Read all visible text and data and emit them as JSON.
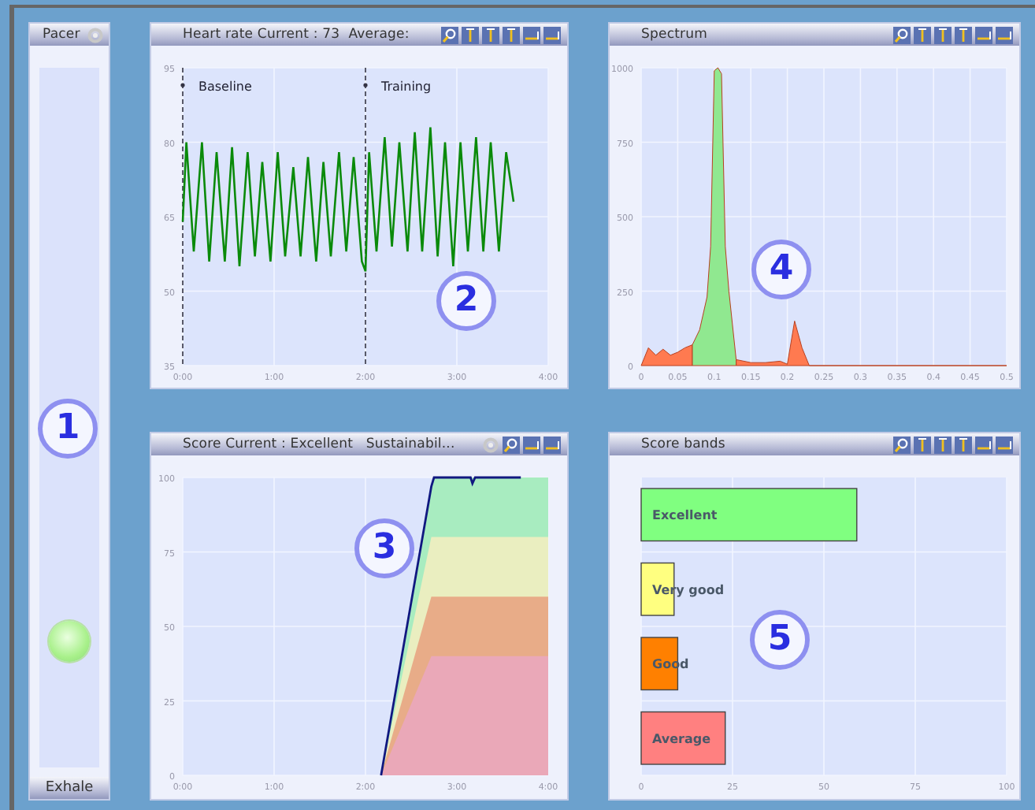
{
  "pacer": {
    "title": "Pacer",
    "footer": "Exhale",
    "level": 0.18
  },
  "panels": [
    {
      "kind": "heart_rate",
      "title": "Heart rate Current : 73  Average:",
      "chart_data": {
        "type": "line",
        "xlim": [
          0,
          4
        ],
        "ylim": [
          35,
          95
        ],
        "xticks": [
          {
            "value": 0,
            "label": "0:00"
          },
          {
            "value": 1,
            "label": "1:00"
          },
          {
            "value": 2,
            "label": "2:00"
          },
          {
            "value": 3,
            "label": "3:00"
          },
          {
            "value": 4,
            "label": "4:00"
          }
        ],
        "yticks": [
          35,
          50,
          65,
          80,
          95
        ],
        "x": [
          0,
          0.04,
          0.12,
          0.21,
          0.29,
          0.37,
          0.46,
          0.54,
          0.62,
          0.71,
          0.79,
          0.87,
          0.96,
          1.04,
          1.12,
          1.21,
          1.29,
          1.37,
          1.46,
          1.54,
          1.62,
          1.71,
          1.79,
          1.87,
          1.96,
          2.0,
          2.04,
          2.12,
          2.21,
          2.29,
          2.37,
          2.46,
          2.54,
          2.62,
          2.71,
          2.79,
          2.87,
          2.96,
          3.04,
          3.12,
          3.21,
          3.29,
          3.37,
          3.46,
          3.54,
          3.62
        ],
        "series": [
          {
            "color": "#0a8a0a",
            "values": [
              64,
              80,
              58,
              80,
              56,
              78,
              56,
              79,
              55,
              78,
              57,
              76,
              56,
              78,
              57,
              75,
              57,
              77,
              56,
              76,
              57,
              78,
              58,
              77,
              56,
              54,
              78,
              58,
              81,
              59,
              80,
              58,
              82,
              58,
              83,
              57,
              80,
              55,
              80,
              58,
              81,
              58,
              80,
              58,
              78,
              68
            ]
          }
        ],
        "grid": true,
        "ref_lines": [
          {
            "axis": "x",
            "value": 0,
            "label": "Baseline"
          },
          {
            "axis": "x",
            "value": 2,
            "label": "Training"
          }
        ]
      }
    },
    {
      "kind": "spectrum",
      "title": "Spectrum",
      "chart_data": {
        "type": "area",
        "xlim": [
          0,
          0.5
        ],
        "ylim": [
          0,
          1000
        ],
        "xticks": [
          0,
          0.05,
          0.1,
          0.15,
          0.2,
          0.25,
          0.3,
          0.35,
          0.4,
          0.45,
          0.5
        ],
        "yticks": [
          0,
          250,
          500,
          750,
          1000
        ],
        "grid": true,
        "x": [
          0,
          0.01,
          0.02,
          0.03,
          0.04,
          0.05,
          0.06,
          0.07,
          0.08,
          0.09,
          0.095,
          0.1,
          0.105,
          0.11,
          0.115,
          0.12,
          0.13,
          0.15,
          0.17,
          0.19,
          0.2,
          0.21,
          0.22,
          0.23,
          0.5
        ],
        "series": [
          {
            "color": "#ff7a50",
            "values": [
              0,
              60,
              35,
              55,
              35,
              45,
              60,
              70,
              null,
              null,
              null,
              null,
              null,
              null,
              null,
              null,
              20,
              10,
              10,
              15,
              5,
              150,
              60,
              0,
              0
            ]
          },
          {
            "color": "#90e890",
            "values": [
              null,
              null,
              null,
              null,
              null,
              null,
              null,
              70,
              120,
              230,
              400,
              990,
              1000,
              980,
              400,
              250,
              20,
              null,
              null,
              null,
              null,
              null,
              null,
              null,
              null
            ]
          }
        ]
      }
    },
    {
      "kind": "score",
      "title": "Score Current : Excellent   Sustainabil...",
      "chart_data": {
        "type": "area",
        "xlim": [
          0,
          4
        ],
        "ylim": [
          0,
          100
        ],
        "xticks": [
          {
            "value": 0,
            "label": "0:00"
          },
          {
            "value": 1,
            "label": "1:00"
          },
          {
            "value": 2,
            "label": "2:00"
          },
          {
            "value": 3,
            "label": "3:00"
          },
          {
            "value": 4,
            "label": "4:00"
          }
        ],
        "yticks": [
          0,
          25,
          50,
          75,
          100
        ],
        "grid": true,
        "x": [
          2.17,
          2.72,
          2.75,
          3.15,
          3.17,
          3.2,
          3.7,
          4.0
        ],
        "series": [
          {
            "type": "area",
            "color": "#a8ecc0",
            "values": [
              0,
              98,
              100,
              100,
              100,
              100,
              100,
              100
            ]
          },
          {
            "type": "area",
            "color": "#eaeec0",
            "values": [
              0,
              80,
              80,
              80,
              80,
              80,
              80,
              80
            ]
          },
          {
            "type": "area",
            "color": "#e8ac88",
            "values": [
              0,
              60,
              60,
              60,
              60,
              60,
              60,
              60
            ]
          },
          {
            "type": "area",
            "color": "#eaa8b8",
            "values": [
              0,
              40,
              40,
              40,
              40,
              40,
              40,
              40
            ]
          },
          {
            "type": "line",
            "color": "#101880",
            "values": [
              0,
              97,
              100,
              100,
              98,
              100,
              100,
              null
            ]
          }
        ]
      }
    },
    {
      "kind": "bands",
      "title": "Score bands",
      "chart_data": {
        "type": "bar",
        "orientation": "horizontal",
        "xlim": [
          0,
          100
        ],
        "xticks": [
          0,
          25,
          50,
          75,
          100
        ],
        "grid": true,
        "categories": [
          "Excellent",
          "Very good",
          "Good",
          "Average"
        ],
        "series": [
          {
            "values": [
              59,
              9,
              10,
              23
            ]
          }
        ],
        "colors": [
          "#80ff80",
          "#ffff80",
          "#ff8000",
          "#ff8080"
        ]
      }
    }
  ],
  "badges": [
    "1",
    "2",
    "3",
    "4",
    "5"
  ]
}
